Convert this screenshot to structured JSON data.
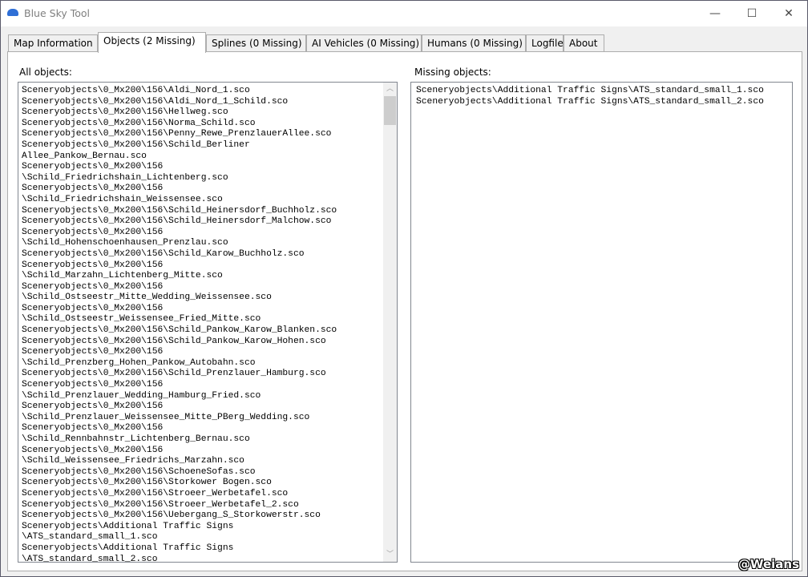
{
  "window": {
    "title": "Blue Sky Tool",
    "minimize": "—",
    "maximize": "☐",
    "close": "✕"
  },
  "tabs": [
    {
      "label": "Map Information"
    },
    {
      "label": "Objects (2 Missing)",
      "active": true
    },
    {
      "label": "Splines (0 Missing)"
    },
    {
      "label": "AI Vehicles (0 Missing)"
    },
    {
      "label": "Humans (0 Missing)"
    },
    {
      "label": "Logfile"
    },
    {
      "label": "About"
    }
  ],
  "all_objects": {
    "label": "All objects:",
    "lines": [
      "Sceneryobjects\\0_Mx200\\156\\Aldi_Nord_1.sco",
      "Sceneryobjects\\0_Mx200\\156\\Aldi_Nord_1_Schild.sco",
      "Sceneryobjects\\0_Mx200\\156\\Hellweg.sco",
      "Sceneryobjects\\0_Mx200\\156\\Norma_Schild.sco",
      "Sceneryobjects\\0_Mx200\\156\\Penny_Rewe_PrenzlauerAllee.sco",
      "Sceneryobjects\\0_Mx200\\156\\Schild_Berliner",
      "Allee_Pankow_Bernau.sco",
      "Sceneryobjects\\0_Mx200\\156",
      "\\Schild_Friedrichshain_Lichtenberg.sco",
      "Sceneryobjects\\0_Mx200\\156",
      "\\Schild_Friedrichshain_Weissensee.sco",
      "Sceneryobjects\\0_Mx200\\156\\Schild_Heinersdorf_Buchholz.sco",
      "Sceneryobjects\\0_Mx200\\156\\Schild_Heinersdorf_Malchow.sco",
      "Sceneryobjects\\0_Mx200\\156",
      "\\Schild_Hohenschoenhausen_Prenzlau.sco",
      "Sceneryobjects\\0_Mx200\\156\\Schild_Karow_Buchholz.sco",
      "Sceneryobjects\\0_Mx200\\156",
      "\\Schild_Marzahn_Lichtenberg_Mitte.sco",
      "Sceneryobjects\\0_Mx200\\156",
      "\\Schild_Ostseestr_Mitte_Wedding_Weissensee.sco",
      "Sceneryobjects\\0_Mx200\\156",
      "\\Schild_Ostseestr_Weissensee_Fried_Mitte.sco",
      "Sceneryobjects\\0_Mx200\\156\\Schild_Pankow_Karow_Blanken.sco",
      "Sceneryobjects\\0_Mx200\\156\\Schild_Pankow_Karow_Hohen.sco",
      "Sceneryobjects\\0_Mx200\\156",
      "\\Schild_Prenzberg_Hohen_Pankow_Autobahn.sco",
      "Sceneryobjects\\0_Mx200\\156\\Schild_Prenzlauer_Hamburg.sco",
      "Sceneryobjects\\0_Mx200\\156",
      "\\Schild_Prenzlauer_Wedding_Hamburg_Fried.sco",
      "Sceneryobjects\\0_Mx200\\156",
      "\\Schild_Prenzlauer_Weissensee_Mitte_PBerg_Wedding.sco",
      "Sceneryobjects\\0_Mx200\\156",
      "\\Schild_Rennbahnstr_Lichtenberg_Bernau.sco",
      "Sceneryobjects\\0_Mx200\\156",
      "\\Schild_Weissensee_Friedrichs_Marzahn.sco",
      "Sceneryobjects\\0_Mx200\\156\\SchoeneSofas.sco",
      "Sceneryobjects\\0_Mx200\\156\\Storkower Bogen.sco",
      "Sceneryobjects\\0_Mx200\\156\\Stroeer_Werbetafel.sco",
      "Sceneryobjects\\0_Mx200\\156\\Stroeer_Werbetafel_2.sco",
      "Sceneryobjects\\0_Mx200\\156\\Uebergang_S_Storkowerstr.sco",
      "Sceneryobjects\\Additional Traffic Signs",
      "\\ATS_standard_small_1.sco",
      "Sceneryobjects\\Additional Traffic Signs",
      "\\ATS_standard_small_2.sco"
    ]
  },
  "missing_objects": {
    "label": "Missing objects:",
    "lines": [
      "Sceneryobjects\\Additional Traffic Signs\\ATS_standard_small_1.sco",
      "Sceneryobjects\\Additional Traffic Signs\\ATS_standard_small_2.sco"
    ]
  },
  "watermark": "@Weians"
}
